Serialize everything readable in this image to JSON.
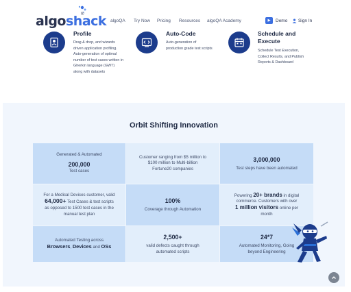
{
  "header": {
    "logo": {
      "part1": "algo",
      "part2": "shack",
      "reg": "®"
    },
    "nav": [
      "algoQA",
      "Try Now",
      "Pricing",
      "Resources",
      "algoQA Academy"
    ],
    "demo_label": "Demo",
    "signin_label": "Sign In"
  },
  "features": [
    {
      "title": "Profile",
      "desc": [
        "Drag & drop, and wizards",
        "driven application profiling.",
        "Auto-generation of optimal",
        "number of test cases written in",
        "Gherkin language (GWT)",
        "along with datasets"
      ],
      "icon": "profile-icon"
    },
    {
      "title": "Auto-Code",
      "desc": [
        "Auto-generation of",
        "production grade test scripts"
      ],
      "icon": "code-icon"
    },
    {
      "title_lines": [
        "Schedule and",
        "Execute"
      ],
      "desc": [
        "Schedule Test Execution,",
        "Collect Results, and Publish",
        "Reports & Dashboard"
      ],
      "icon": "calendar-icon"
    }
  ],
  "section": {
    "title": "Orbit Shifting Innovation",
    "cells": {
      "c1": {
        "top": "Generated & Automated",
        "big": "200,000",
        "bottom": "Test cases"
      },
      "c2": {
        "lines": [
          "Customer ranging from $5 million to",
          "$100 million to Multi-billion",
          "Fortune20 companies"
        ]
      },
      "c3": {
        "big": "3,000,000",
        "bottom": "Test steps have been automated"
      },
      "c4": {
        "line1": "For a Medical Devices customer, valid",
        "big": "64,000+",
        "line2_rest": " Test Cases & test scripts",
        "line3": "as opposed to 1500 test cases in the",
        "line4": "manual test plan"
      },
      "c5": {
        "big": "100%",
        "bottom": "Coverage through Automation"
      },
      "c6": {
        "pre": "Powering ",
        "brands": "20+ brands",
        "post": " in digital",
        "line2": "commerce. Customers with over",
        "visitors": "1 million visitors",
        "post2": " online per",
        "line4": "month"
      },
      "c7": {
        "top": "Automated Testing across",
        "b1": "Browsers",
        "comma": ", ",
        "b2": "Devices",
        "and": " and ",
        "b3": "OSs"
      },
      "c8": {
        "big": "2,500+",
        "lines": [
          "valid defects caught through",
          "automated scripts"
        ]
      },
      "c9": {
        "big": "24*7",
        "lines": [
          "Automated Monitoring, Going",
          "beyond Engineering"
        ]
      }
    }
  },
  "colors": {
    "accent": "#3c6fe0",
    "icon_bg": "#1c3c8c",
    "cell_dark": "#c5dcf7",
    "cell_light": "#e2eefb",
    "section_bg": "#f1f6fd"
  }
}
